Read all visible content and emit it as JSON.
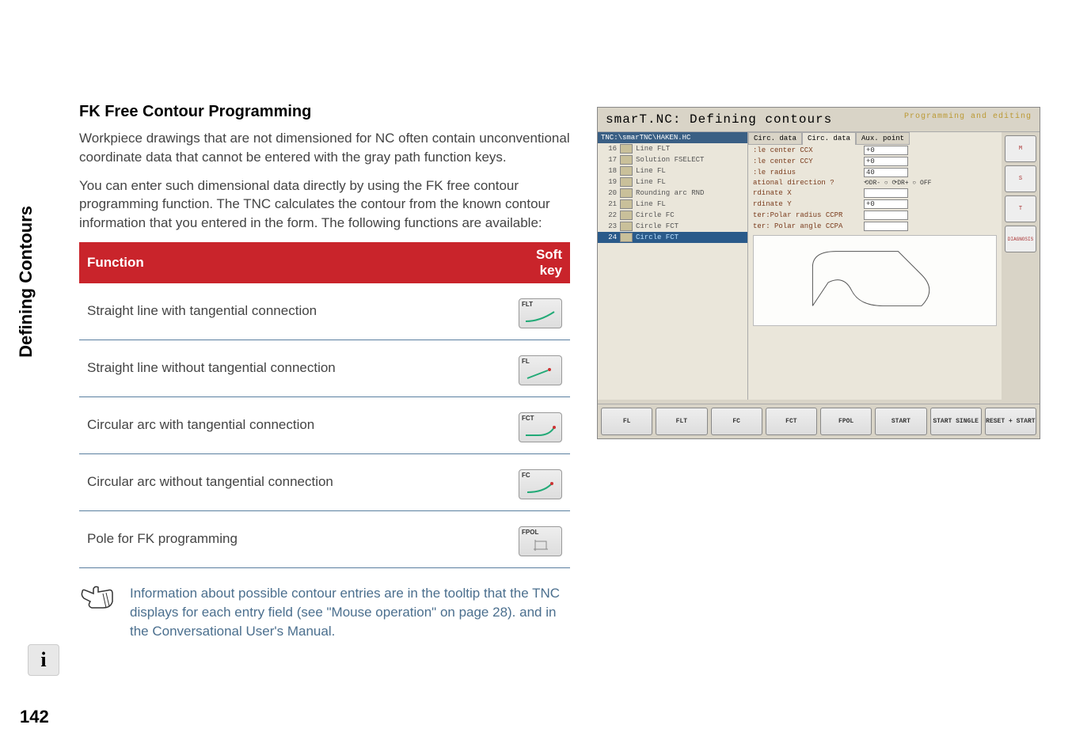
{
  "sidebar": {
    "tab_label": "Defining Contours"
  },
  "page_number": "142",
  "heading": "FK Free Contour Programming",
  "para1": "Workpiece drawings that are not dimensioned for NC often contain unconventional coordinate data that cannot be entered with the gray path function keys.",
  "para2": "You can enter such dimensional data directly by using the FK free contour programming function. The TNC calculates the contour from the known contour information that you entered in the form. The following functions are available:",
  "table": {
    "head": {
      "fn": "Function",
      "sk": "Soft key"
    },
    "rows": [
      {
        "fn": "Straight line with tangential connection",
        "sk": "FLT"
      },
      {
        "fn": "Straight line without tangential connection",
        "sk": "FL"
      },
      {
        "fn": "Circular arc with tangential connection",
        "sk": "FCT"
      },
      {
        "fn": "Circular arc without tangential connection",
        "sk": "FC"
      },
      {
        "fn": "Pole for FK programming",
        "sk": "FPOL"
      }
    ]
  },
  "note": "Information about possible contour entries are in the tooltip that the TNC displays for each entry field (see \"Mouse operation\" on page  28). and in the Conversational User's Manual.",
  "app": {
    "title": "smarT.NC: Defining contours",
    "mode": "Programming and editing",
    "path": "TNC:\\smarTNC\\HAKEN.HC",
    "tree": [
      {
        "n": "16",
        "lbl": "Line FLT"
      },
      {
        "n": "17",
        "lbl": "Solution FSELECT"
      },
      {
        "n": "18",
        "lbl": "Line FL"
      },
      {
        "n": "19",
        "lbl": "Line FL"
      },
      {
        "n": "20",
        "lbl": "Rounding arc RND"
      },
      {
        "n": "21",
        "lbl": "Line FL"
      },
      {
        "n": "22",
        "lbl": "Circle FC"
      },
      {
        "n": "23",
        "lbl": "Circle FCT"
      },
      {
        "n": "24",
        "lbl": "Circle FCT"
      }
    ],
    "tabs": [
      "Circ. data",
      "Circ. data",
      "Aux. point"
    ],
    "form": {
      "ccx": {
        "lbl": ":le center CCX",
        "val": "+0"
      },
      "ccy": {
        "lbl": ":le center CCY",
        "val": "+0"
      },
      "rad": {
        "lbl": ":le radius",
        "val": "40"
      },
      "dir": {
        "lbl": "ational direction ?"
      },
      "cx": {
        "lbl": "rdinate X",
        "val": ""
      },
      "cy": {
        "lbl": "rdinate Y",
        "val": "+0"
      },
      "pr": {
        "lbl": "ter:Polar radius CCPR",
        "val": ""
      },
      "pa": {
        "lbl": "ter: Polar angle CCPA",
        "val": ""
      }
    },
    "icons": [
      "M",
      "S",
      "T",
      "DIAGNOSIS"
    ],
    "softkeys": [
      "FL",
      "FLT",
      "FC",
      "FCT",
      "FPOL",
      "START",
      "START SINGLE",
      "RESET + START"
    ]
  }
}
